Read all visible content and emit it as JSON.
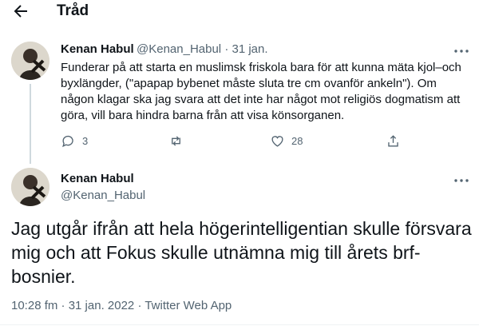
{
  "header": {
    "title": "Tråd",
    "back_icon": "arrow-left-icon"
  },
  "reply_tweet": {
    "name": "Kenan Habul",
    "handle": "@Kenan_Habul",
    "separator": "·",
    "date": "31 jan.",
    "text": "Funderar på att starta en muslimsk friskola bara för att kunna mäta kjol–och byxlängder, (\"apapap bybenet måste sluta tre cm ovanför ankeln\"). Om någon klagar ska jag svara att det inte har något mot religiös dogmatism att göra, vill bara hindra barna från att visa könsorganen.",
    "actions": {
      "reply": {
        "icon": "comment-icon",
        "count": "3"
      },
      "retweet": {
        "icon": "retweet-icon",
        "count": ""
      },
      "like": {
        "icon": "heart-icon",
        "count": "28"
      },
      "share": {
        "icon": "share-icon",
        "count": ""
      }
    }
  },
  "main_tweet": {
    "name": "Kenan Habul",
    "handle": "@Kenan_Habul",
    "text": "Jag utgår ifrån att hela högerintelligentian skulle försvara mig och att Fokus skulle utnämna mig till årets brf-bosnier.",
    "timestamp": "10:28 fm · 31 jan. 2022 · Twitter Web App"
  },
  "colors": {
    "text": "#0f1419",
    "secondary": "#536471",
    "line": "#cfd9de"
  }
}
